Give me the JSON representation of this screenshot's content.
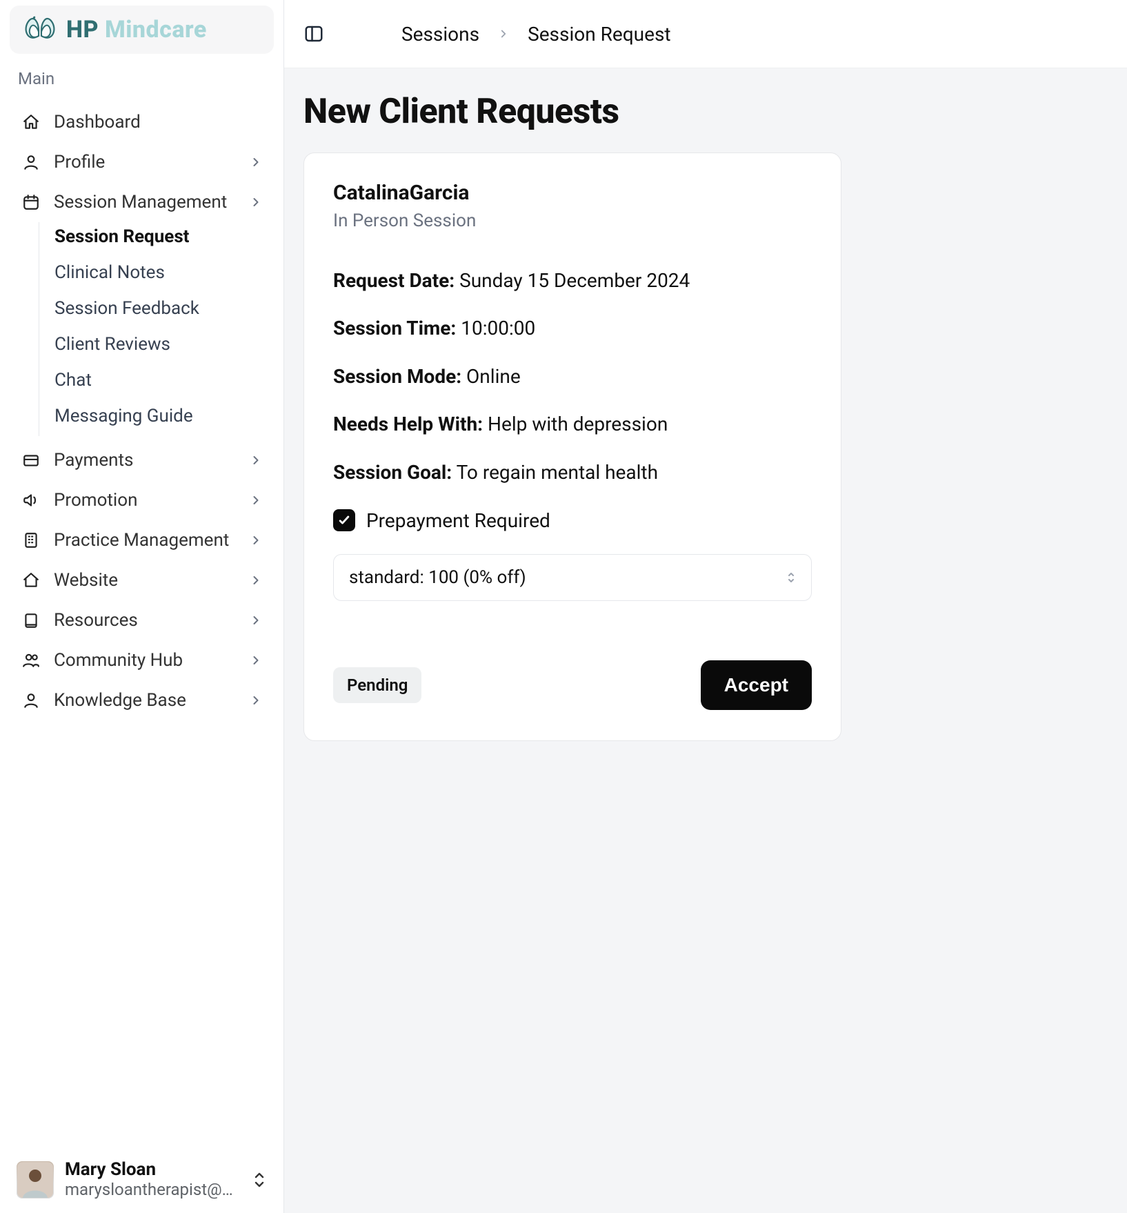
{
  "brand": {
    "hp": "HP",
    "mc": " Mindcare"
  },
  "sidebar": {
    "section_label": "Main",
    "items": [
      {
        "icon": "home",
        "label": "Dashboard",
        "has_children": false
      },
      {
        "icon": "user",
        "label": "Profile",
        "has_children": true
      },
      {
        "icon": "calendar",
        "label": "Session Management",
        "has_children": true
      },
      {
        "icon": "card",
        "label": "Payments",
        "has_children": true
      },
      {
        "icon": "megaphone",
        "label": "Promotion",
        "has_children": true
      },
      {
        "icon": "building",
        "label": "Practice Management",
        "has_children": true
      },
      {
        "icon": "home",
        "label": "Website",
        "has_children": true
      },
      {
        "icon": "book",
        "label": "Resources",
        "has_children": true
      },
      {
        "icon": "users",
        "label": "Community Hub",
        "has_children": true
      },
      {
        "icon": "user",
        "label": "Knowledge Base",
        "has_children": true
      }
    ],
    "session_sub": [
      {
        "label": "Session Request",
        "active": true
      },
      {
        "label": "Clinical Notes"
      },
      {
        "label": "Session Feedback"
      },
      {
        "label": "Client Reviews"
      },
      {
        "label": "Chat"
      },
      {
        "label": "Messaging Guide"
      }
    ]
  },
  "user": {
    "name": "Mary Sloan",
    "email": "marysloantherapist@gmai..."
  },
  "breadcrumb": {
    "a": "Sessions",
    "b": "Session Request"
  },
  "page": {
    "title": "New Client Requests"
  },
  "request": {
    "client_name": "CatalinaGarcia",
    "session_type": "In Person Session",
    "labels": {
      "request_date": "Request Date:",
      "session_time": "Session Time:",
      "session_mode": "Session Mode:",
      "needs_help_with": "Needs Help With:",
      "session_goal": "Session Goal:",
      "prepayment": "Prepayment Required"
    },
    "values": {
      "request_date": "Sunday 15 December 2024",
      "session_time": "10:00:00",
      "session_mode": "Online",
      "needs_help_with": "Help with depression",
      "session_goal": "To regain mental health"
    },
    "prepayment_checked": true,
    "pricing_selected": "standard: 100 (0% off)",
    "status_badge": "Pending",
    "accept_label": "Accept"
  }
}
